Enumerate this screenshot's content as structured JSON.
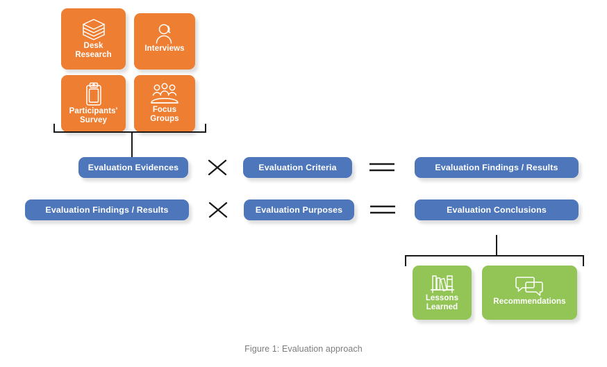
{
  "figure": {
    "caption": "Figure 1: Evaluation approach",
    "colors": {
      "orange": "#EE7E32",
      "green": "#92C556",
      "blue": "#4E76BB",
      "connector": "#1A1A1A",
      "caption_text": "#7C7C7C",
      "background": "#FFFFFF"
    }
  },
  "evidence_methods": [
    {
      "label": "Desk\nResearch",
      "icon": "books-stack-icon"
    },
    {
      "label": "Interviews",
      "icon": "person-headset-icon"
    },
    {
      "label": "Participants'\nSurvey",
      "icon": "clipboard-icon"
    },
    {
      "label": "Focus\nGroups",
      "icon": "group-meeting-icon"
    }
  ],
  "equations": [
    {
      "left": "Evaluation Evidences",
      "operator": "times-icon",
      "middle": "Evaluation Criteria",
      "equals": "equals-icon",
      "result": "Evaluation Findings / Results"
    },
    {
      "left": "Evaluation Findings / Results",
      "operator": "times-icon",
      "middle": "Evaluation Purposes",
      "equals": "equals-icon",
      "result": "Evaluation Conclusions"
    }
  ],
  "outputs": [
    {
      "label": "Lessons\nLearned",
      "icon": "bookshelf-icon"
    },
    {
      "label": "Recommendations",
      "icon": "speech-bubbles-icon"
    }
  ]
}
